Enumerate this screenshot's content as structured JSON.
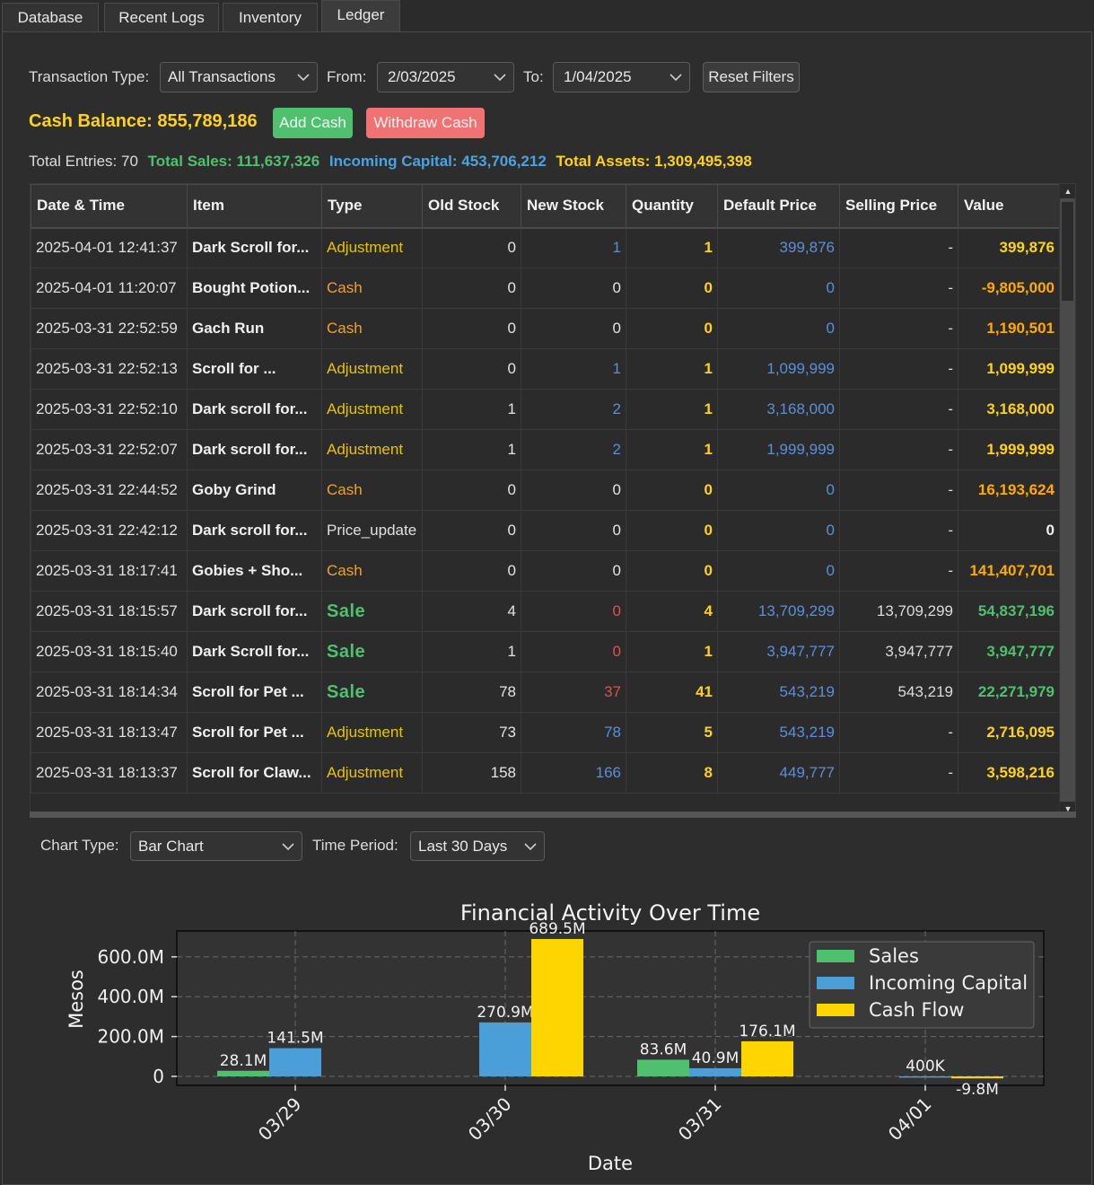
{
  "tabs": [
    "Database",
    "Recent Logs",
    "Inventory",
    "Ledger"
  ],
  "active_tab": "Ledger",
  "filters": {
    "transaction_type_label": "Transaction Type:",
    "transaction_type_value": "All Transactions",
    "from_label": "From:",
    "from_value": "2/03/2025",
    "to_label": "To:",
    "to_value": "1/04/2025",
    "reset_label": "Reset Filters"
  },
  "cash": {
    "balance_text": "Cash Balance: 855,789,186",
    "add_label": "Add Cash",
    "withdraw_label": "Withdraw Cash"
  },
  "stats": {
    "total_entries": "Total Entries: 70",
    "total_sales": "Total Sales: 111,637,326",
    "incoming_capital": "Incoming Capital: 453,706,212",
    "total_assets": "Total Assets: 1,309,495,398"
  },
  "table": {
    "columns": [
      "Date & Time",
      "Item",
      "Type",
      "Old Stock",
      "New Stock",
      "Quantity",
      "Default Price",
      "Selling Price",
      "Value"
    ],
    "rows": [
      {
        "date": "2025-04-01 12:41:37",
        "item": "Dark Scroll for...",
        "type": "Adjustment",
        "old": "0",
        "new": "1",
        "qty": "1",
        "default_price": "399,876",
        "selling_price": "-",
        "value": "399,876",
        "new_color": "blue",
        "value_color": "yellow"
      },
      {
        "date": "2025-04-01 11:20:07",
        "item": "Bought Potion...",
        "type": "Cash",
        "old": "0",
        "new": "0",
        "qty": "0",
        "default_price": "0",
        "selling_price": "-",
        "value": "-9,805,000",
        "new_color": "gray",
        "value_color": "orange"
      },
      {
        "date": "2025-03-31 22:52:59",
        "item": "Gach Run",
        "type": "Cash",
        "old": "0",
        "new": "0",
        "qty": "0",
        "default_price": "0",
        "selling_price": "-",
        "value": "1,190,501",
        "new_color": "gray",
        "value_color": "orange"
      },
      {
        "date": "2025-03-31 22:52:13",
        "item": "Scroll for ...",
        "type": "Adjustment",
        "old": "0",
        "new": "1",
        "qty": "1",
        "default_price": "1,099,999",
        "selling_price": "-",
        "value": "1,099,999",
        "new_color": "blue",
        "value_color": "yellow"
      },
      {
        "date": "2025-03-31 22:52:10",
        "item": "Dark scroll for...",
        "type": "Adjustment",
        "old": "1",
        "new": "2",
        "qty": "1",
        "default_price": "3,168,000",
        "selling_price": "-",
        "value": "3,168,000",
        "new_color": "blue",
        "value_color": "yellow"
      },
      {
        "date": "2025-03-31 22:52:07",
        "item": "Dark scroll for...",
        "type": "Adjustment",
        "old": "1",
        "new": "2",
        "qty": "1",
        "default_price": "1,999,999",
        "selling_price": "-",
        "value": "1,999,999",
        "new_color": "blue",
        "value_color": "yellow"
      },
      {
        "date": "2025-03-31 22:44:52",
        "item": "Goby Grind",
        "type": "Cash",
        "old": "0",
        "new": "0",
        "qty": "0",
        "default_price": "0",
        "selling_price": "-",
        "value": "16,193,624",
        "new_color": "gray",
        "value_color": "orange"
      },
      {
        "date": "2025-03-31 22:42:12",
        "item": "Dark scroll for...",
        "type": "Price_update",
        "old": "0",
        "new": "0",
        "qty": "0",
        "default_price": "0",
        "selling_price": "-",
        "value": "0",
        "new_color": "gray",
        "value_color": "white"
      },
      {
        "date": "2025-03-31 18:17:41",
        "item": "Gobies + Sho...",
        "type": "Cash",
        "old": "0",
        "new": "0",
        "qty": "0",
        "default_price": "0",
        "selling_price": "-",
        "value": "141,407,701",
        "new_color": "gray",
        "value_color": "orange"
      },
      {
        "date": "2025-03-31 18:15:57",
        "item": "Dark scroll for...",
        "type": "Sale",
        "old": "4",
        "new": "0",
        "qty": "4",
        "default_price": "13,709,299",
        "selling_price": "13,709,299",
        "value": "54,837,196",
        "new_color": "red",
        "value_color": "green"
      },
      {
        "date": "2025-03-31 18:15:40",
        "item": "Dark Scroll for...",
        "type": "Sale",
        "old": "1",
        "new": "0",
        "qty": "1",
        "default_price": "3,947,777",
        "selling_price": "3,947,777",
        "value": "3,947,777",
        "new_color": "red",
        "value_color": "green"
      },
      {
        "date": "2025-03-31 18:14:34",
        "item": "Scroll for Pet ...",
        "type": "Sale",
        "old": "78",
        "new": "37",
        "qty": "41",
        "default_price": "543,219",
        "selling_price": "543,219",
        "value": "22,271,979",
        "new_color": "red",
        "value_color": "green"
      },
      {
        "date": "2025-03-31 18:13:47",
        "item": "Scroll for Pet ...",
        "type": "Adjustment",
        "old": "73",
        "new": "78",
        "qty": "5",
        "default_price": "543,219",
        "selling_price": "-",
        "value": "2,716,095",
        "new_color": "blue",
        "value_color": "yellow"
      },
      {
        "date": "2025-03-31 18:13:37",
        "item": "Scroll for Claw...",
        "type": "Adjustment",
        "old": "158",
        "new": "166",
        "qty": "8",
        "default_price": "449,777",
        "selling_price": "-",
        "value": "3,598,216",
        "new_color": "blue",
        "value_color": "yellow"
      }
    ]
  },
  "chart_controls": {
    "chart_type_label": "Chart Type:",
    "chart_type_value": "Bar Chart",
    "period_label": "Time Period:",
    "period_value": "Last 30 Days"
  },
  "chart_data": {
    "type": "bar",
    "title": "Financial Activity Over Time",
    "xlabel": "Date",
    "ylabel": "Mesos",
    "categories": [
      "03/29",
      "03/30",
      "03/31",
      "04/01"
    ],
    "series": [
      {
        "name": "Sales",
        "color": "#4fc16e",
        "values": [
          28.1,
          0,
          83.6,
          0
        ],
        "labels": [
          "28.1M",
          "",
          "83.6M",
          ""
        ]
      },
      {
        "name": "Incoming Capital",
        "color": "#4a9fd8",
        "values": [
          141.5,
          270.9,
          40.9,
          0.4
        ],
        "labels": [
          "141.5M",
          "270.9M",
          "40.9M",
          "400K"
        ]
      },
      {
        "name": "Cash Flow",
        "color": "#ffd500",
        "values": [
          0,
          689.5,
          176.1,
          -9.8
        ],
        "labels": [
          "",
          "689.5M",
          "176.1M",
          "-9.8M"
        ]
      }
    ],
    "yticks": [
      "0",
      "200.0M",
      "400.0M",
      "600.0M"
    ],
    "ytick_values": [
      0,
      200,
      400,
      600
    ],
    "ylim": [
      -45,
      730
    ],
    "grid": true,
    "legend_position": "top-right"
  }
}
